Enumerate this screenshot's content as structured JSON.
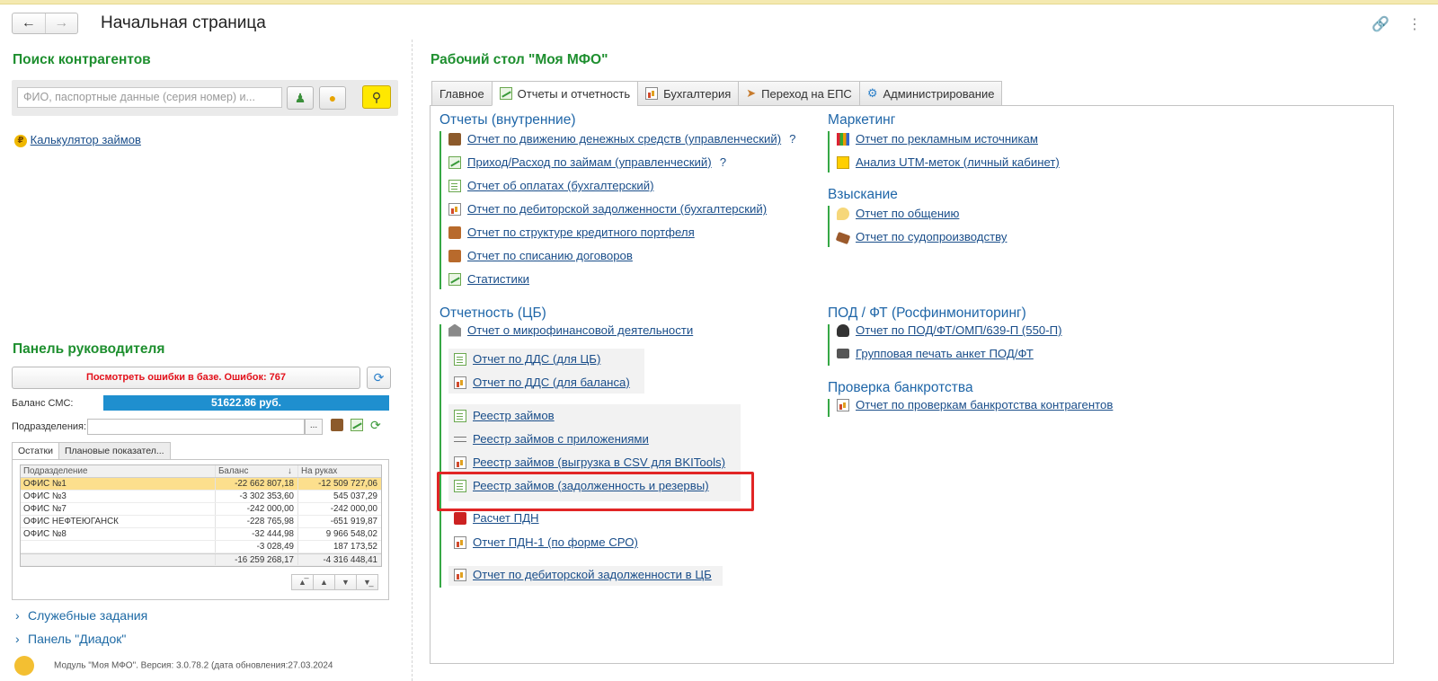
{
  "header": {
    "back_icon": "arrow-left-icon",
    "forward_icon": "arrow-right-icon",
    "title": "Начальная страница",
    "link_icon": "link-icon",
    "more_icon": "more-vertical-icon"
  },
  "left": {
    "search_title": "Поиск контрагентов",
    "search_placeholder": "ФИО, паспортные данные (серия номер) и...",
    "calculator_link": "Калькулятор займов",
    "manager_panel_title": "Панель руководителя",
    "errors_button": "Посмотреть ошибки в базе. Ошибок: 767",
    "sms_balance_label": "Баланс СМС:",
    "sms_balance_value": "51622.86 руб.",
    "division_label": "Подразделения:",
    "division_dots": "...",
    "tabs": [
      "Остатки",
      "Плановые показател..."
    ],
    "table": {
      "headers": [
        "Подразделение",
        "Баланс",
        "На руках"
      ],
      "sort_indicator": "↓",
      "rows": [
        {
          "name": "ОФИС №1",
          "balance": "-22 662 807,18",
          "onhand": "-12 509 727,06"
        },
        {
          "name": "ОФИС №3",
          "balance": "-3 302 353,60",
          "onhand": "545 037,29"
        },
        {
          "name": "ОФИС №7",
          "balance": "-242 000,00",
          "onhand": "-242 000,00"
        },
        {
          "name": "ОФИС НЕФТЕЮГАНСК",
          "balance": "-228 765,98",
          "onhand": "-651 919,87"
        },
        {
          "name": "ОФИС №8",
          "balance": "-32 444,98",
          "onhand": "9 966 548,02"
        },
        {
          "name": "",
          "balance": "-3 028,49",
          "onhand": "187 173,52"
        }
      ],
      "total": {
        "balance": "-16 259 268,17",
        "onhand": "-4 316 448,41"
      }
    },
    "collapsibles": [
      "Служебные задания",
      "Панель \"Диадок\""
    ],
    "footer_note": "Модуль \"Моя МФО\". Версия: 3.0.78.2 (дата обновления:27.03.2024"
  },
  "right": {
    "title": "Рабочий стол \"Моя МФО\"",
    "tabs": [
      "Главное",
      "Отчеты и отчетность",
      "Бухгалтерия",
      "Переход на ЕПС",
      "Администрирование"
    ],
    "groups": {
      "internal": {
        "title": "Отчеты (внутренние)",
        "links": [
          "Отчет по движению денежных средств (управленческий)",
          "Приход/Расход по займам (управленческий)",
          "Отчет об оплатах (бухгалтерский)",
          "Отчет по дебиторской задолженности (бухгалтерский)",
          "Отчет по структуре кредитного портфеля",
          "Отчет по списанию договоров",
          "Статистики"
        ],
        "help": "?"
      },
      "cb": {
        "title": "Отчетность (ЦБ)",
        "links": [
          "Отчет о микрофинансовой деятельности",
          "Отчет по ДДС (для ЦБ)",
          "Отчет по ДДС (для баланса)",
          "Реестр займов",
          "Реестр займов с приложениями",
          "Реестр займов (выгрузка в CSV для BKITools)",
          "Реестр займов (задолженность и резервы)",
          "Расчет ПДН",
          "Отчет ПДН-1 (по форме СРО)",
          "Отчет по дебиторской задолженности в ЦБ"
        ]
      },
      "marketing": {
        "title": "Маркетинг",
        "links": [
          "Отчет по рекламным источникам",
          "Анализ UTM-меток (личный кабинет)"
        ]
      },
      "collection": {
        "title": "Взыскание",
        "links": [
          "Отчет по общению",
          "Отчет по судопроизводству"
        ]
      },
      "aml": {
        "title": "ПОД / ФТ (Росфинмониторинг)",
        "links": [
          "Отчет по ПОД/ФТ/ОМП/639-П (550-П)",
          "Групповая печать анкет ПОД/ФТ"
        ]
      },
      "bankruptcy": {
        "title": "Проверка банкротства",
        "links": [
          "Отчет по проверкам банкротства контрагентов"
        ]
      }
    }
  },
  "colors": {
    "section_green": "#1e8f2f",
    "group_blue": "#1f66a8",
    "link_blue": "#1a4e8a",
    "error_red": "#e3101a",
    "sms_bar": "#1f8fcf",
    "highlight_frame": "#e12525",
    "search_button": "#ffe800"
  }
}
